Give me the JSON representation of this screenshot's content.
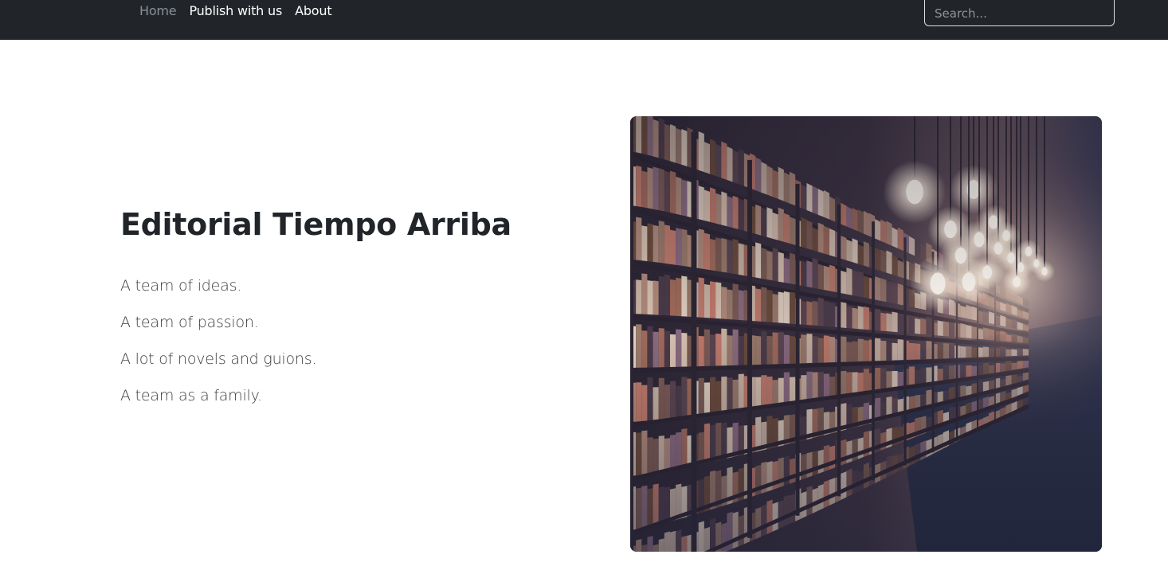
{
  "nav": {
    "links": [
      {
        "label": "Home",
        "active": false
      },
      {
        "label": "Publish with us",
        "active": true
      },
      {
        "label": "About",
        "active": true
      }
    ],
    "search": {
      "placeholder": "Search...",
      "value": ""
    }
  },
  "hero": {
    "title": "Editorial Tiempo Arriba",
    "lines": [
      "A team of ideas.",
      "A team of passion.",
      "A lot of novels and guions.",
      "A team as a family."
    ],
    "image_subject": "library-bookshelves-with-hanging-light-bulbs"
  },
  "colors": {
    "navbar": "#212529",
    "title": "#212529",
    "text": "#3a3d41",
    "muted_link": "#8b9096"
  }
}
